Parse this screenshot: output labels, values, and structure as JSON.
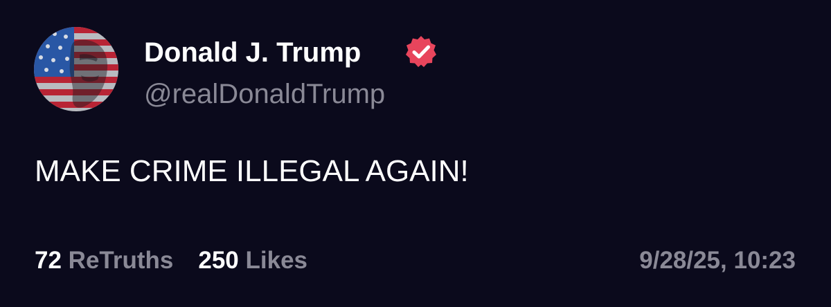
{
  "post": {
    "author": {
      "display_name": "Donald J. Trump",
      "handle": "@realDonaldTrump",
      "verified": true,
      "verified_badge_color": "#e8455c"
    },
    "text": "MAKE CRIME ILLEGAL AGAIN!",
    "stats": {
      "retruths_count": "72",
      "retruths_label": "ReTruths",
      "likes_count": "250",
      "likes_label": "Likes"
    },
    "timestamp": "9/28/25, 10:23"
  },
  "theme": {
    "background": "#0b0a1c",
    "text_primary": "#ffffff",
    "text_secondary": "#8a8996"
  },
  "icons": {
    "avatar": "avatar-flag-face-icon",
    "verified": "verified-badge-icon"
  }
}
